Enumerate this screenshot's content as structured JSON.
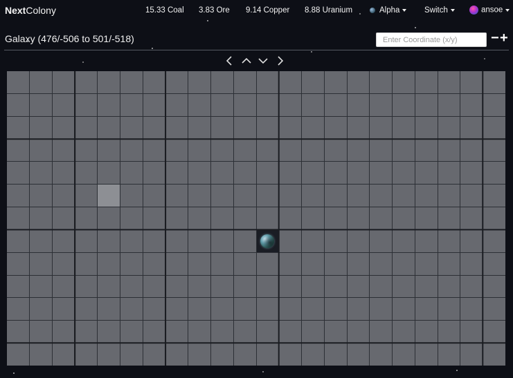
{
  "app": {
    "brand_bold": "Next",
    "brand_rest": "Colony"
  },
  "resources": [
    {
      "label": "15.33 Coal"
    },
    {
      "label": "3.83 Ore"
    },
    {
      "label": "9.14 Copper"
    },
    {
      "label": "8.88 Uranium"
    }
  ],
  "menus": {
    "planet_label": "Alpha",
    "switch_label": "Switch",
    "user_label": "ansoe"
  },
  "galaxy": {
    "title": "Galaxy (476/-506 to 501/-518)",
    "coord_placeholder": "Enter Coordinate (x/y)",
    "zoom_out": "−",
    "zoom_in": "+",
    "columns": 22,
    "rows": 13,
    "highlighted_cell": {
      "col": 4,
      "row": 5
    },
    "planet_cell": {
      "col": 11,
      "row": 7
    }
  },
  "icons": {
    "nav": [
      "chevron-left-icon",
      "chevron-up-icon",
      "chevron-down-icon",
      "chevron-right-icon"
    ]
  },
  "colors": {
    "cell": "#6c6e74",
    "highlight": "#8d8f94",
    "background": "#0d0f16"
  }
}
